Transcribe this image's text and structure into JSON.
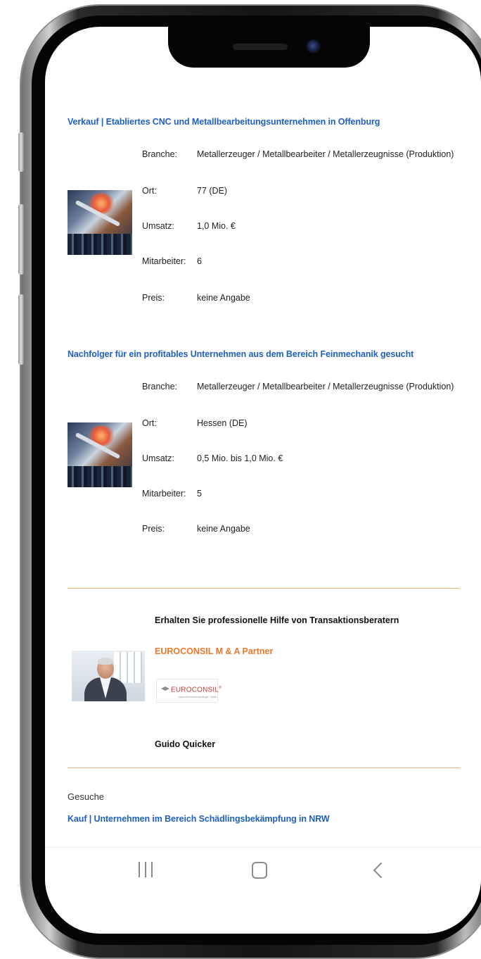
{
  "listings": [
    {
      "title": "Verkauf | Etabliertes CNC und Metallbearbeitungsunternehmen in Offenburg",
      "fields": [
        {
          "label": "Branche:",
          "value": "Metallerzeuger / Metallbearbeiter / Metallerzeugnisse (Produktion)"
        },
        {
          "label": "Ort:",
          "value": "77 (DE)"
        },
        {
          "label": "Umsatz:",
          "value": "1,0 Mio. €"
        },
        {
          "label": "Mitarbeiter:",
          "value": "6"
        },
        {
          "label": "Preis:",
          "value": "keine Angabe"
        }
      ]
    },
    {
      "title": "Nachfolger für ein profitables Unternehmen aus dem Bereich Feinmechanik gesucht",
      "fields": [
        {
          "label": "Branche:",
          "value": "Metallerzeuger / Metallbearbeiter / Metallerzeugnisse (Produktion)"
        },
        {
          "label": "Ort:",
          "value": "Hessen (DE)"
        },
        {
          "label": "Umsatz:",
          "value": "0,5 Mio. bis 1,0 Mio. €"
        },
        {
          "label": "Mitarbeiter:",
          "value": "5"
        },
        {
          "label": "Preis:",
          "value": "keine Angabe"
        }
      ]
    }
  ],
  "advisor": {
    "heading": "Erhalten Sie professionelle Hilfe von Transaktionsberatern",
    "company_link": "EUROCONSIL M & A Partner",
    "logo_text": "EUROCONSIL",
    "logo_mark": "®",
    "logo_subtext": "Unternehmensnachfolge / M&A",
    "person_name": "Guido Quicker"
  },
  "searches": {
    "heading": "Gesuche",
    "items": [
      "Kauf | Unternehmen im Bereich Schädlingsbekämpfung in NRW"
    ]
  },
  "colors": {
    "link_blue": "#1f5fbf",
    "accent_orange": "#e9782b",
    "divider": "#f0b27a"
  }
}
